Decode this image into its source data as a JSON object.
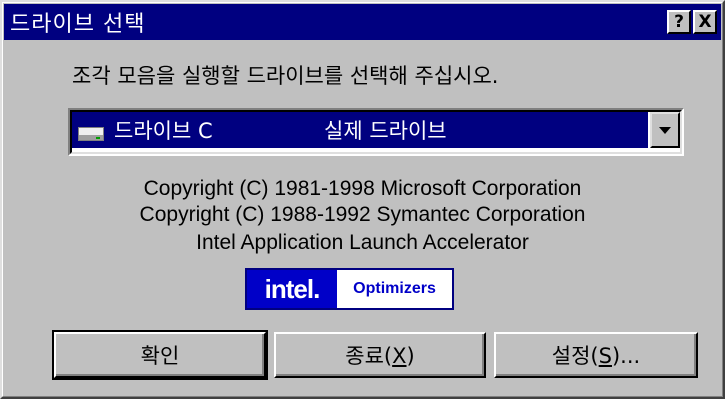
{
  "window": {
    "title": "드라이브 선택",
    "help_label": "?",
    "close_label": "X"
  },
  "prompt": "조각 모음을 실행할 드라이브를 선택해 주십시오.",
  "drive_select": {
    "drive_name": "드라이브 C",
    "drive_type": "실제 드라이브",
    "icon": "hard-drive-icon"
  },
  "copyright": {
    "line1": "Copyright (C) 1981-1998 Microsoft Corporation",
    "line2": "Copyright (C) 1988-1992 Symantec Corporation",
    "line3": "Intel Application Launch Accelerator"
  },
  "logo": {
    "brand": "intel.",
    "text": "Optimizers"
  },
  "buttons": {
    "ok": "확인",
    "exit_prefix": "종료(",
    "exit_key": "X",
    "exit_suffix": ")",
    "settings_prefix": "설정(",
    "settings_key": "S",
    "settings_suffix": ")..."
  },
  "colors": {
    "titlebar": "#000080",
    "face": "#c0c0c0",
    "selection": "#000080",
    "logo_blue": "#0000c8"
  }
}
